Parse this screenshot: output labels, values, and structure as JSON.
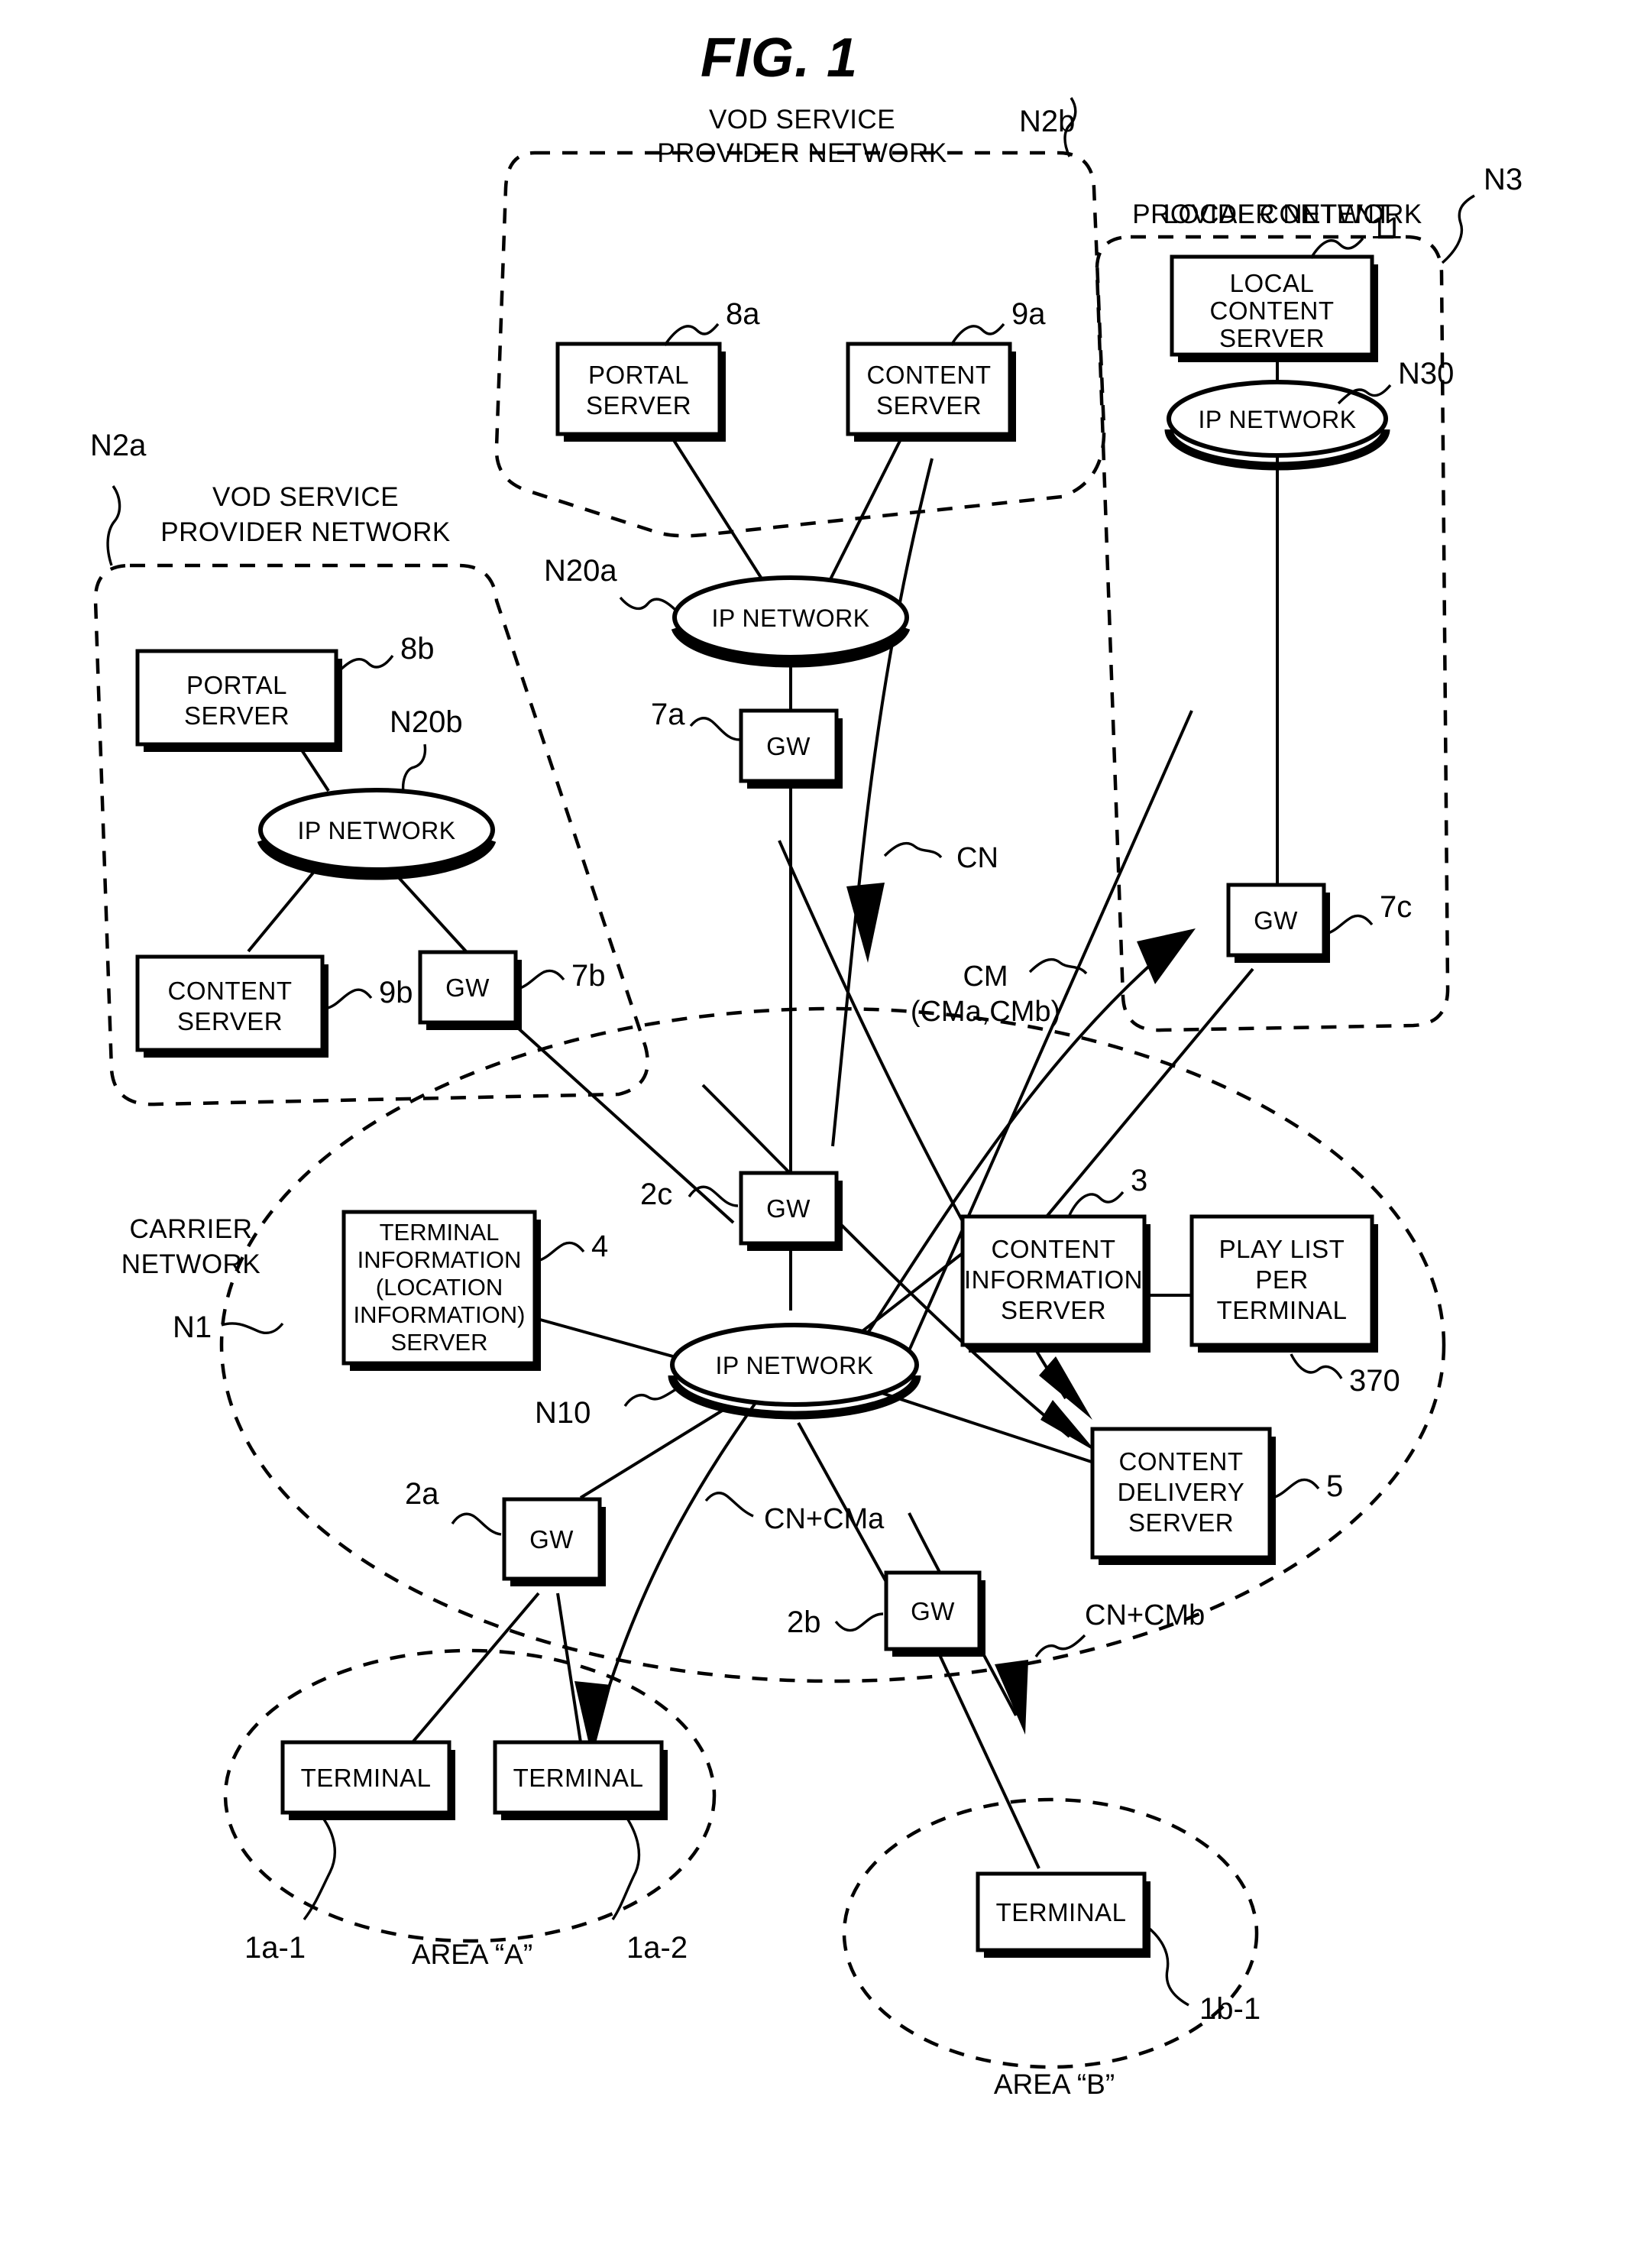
{
  "figure": {
    "title": "FIG. 1"
  },
  "networks": {
    "vod_a": {
      "title_line1": "VOD SERVICE",
      "title_line2": "PROVIDER NETWORK",
      "ref": "N2a"
    },
    "vod_b": {
      "title_line1": "VOD SERVICE",
      "title_line2": "PROVIDER NETWORK",
      "ref": "N2b"
    },
    "local_content": {
      "title_line1": "LOCAL CONTENT",
      "title_line2": "PROVIDER NETWORK",
      "ref": "N3"
    },
    "carrier": {
      "title_line1": "CARRIER",
      "title_line2": "NETWORK",
      "ref": "N1"
    }
  },
  "clouds": {
    "n20a": {
      "label": "IP NETWORK",
      "ref": "N20a"
    },
    "n20b": {
      "label": "IP NETWORK",
      "ref": "N20b"
    },
    "n30": {
      "label": "IP NETWORK",
      "ref": "N30"
    },
    "n10": {
      "label": "IP NETWORK",
      "ref": "N10"
    }
  },
  "blocks": {
    "portal_server_a": {
      "line1": "PORTAL",
      "line2": "SERVER",
      "ref": "8a"
    },
    "content_server_a": {
      "line1": "CONTENT",
      "line2": "SERVER",
      "ref": "9a"
    },
    "portal_server_b": {
      "line1": "PORTAL",
      "line2": "SERVER",
      "ref": "8b"
    },
    "content_server_b": {
      "line1": "CONTENT",
      "line2": "SERVER",
      "ref": "9b"
    },
    "local_content_server": {
      "line1": "LOCAL",
      "line2": "CONTENT",
      "line3": "SERVER",
      "ref": "11"
    },
    "gw_7a": {
      "label": "GW",
      "ref": "7a"
    },
    "gw_7b": {
      "label": "GW",
      "ref": "7b"
    },
    "gw_7c": {
      "label": "GW",
      "ref": "7c"
    },
    "gw_2a": {
      "label": "GW",
      "ref": "2a"
    },
    "gw_2b": {
      "label": "GW",
      "ref": "2b"
    },
    "gw_2c": {
      "label": "GW",
      "ref": "2c"
    },
    "terminal_info_server": {
      "line1": "TERMINAL",
      "line2": "INFORMATION",
      "line3": "(LOCATION",
      "line4": "INFORMATION)",
      "line5": "SERVER",
      "ref": "4"
    },
    "content_info_server": {
      "line1": "CONTENT",
      "line2": "INFORMATION",
      "line3": "SERVER",
      "ref": "3"
    },
    "play_list": {
      "line1": "PLAY LIST",
      "line2": "PER",
      "line3": "TERMINAL",
      "ref": "370"
    },
    "content_delivery_server": {
      "line1": "CONTENT",
      "line2": "DELIVERY",
      "line3": "SERVER",
      "ref": "5"
    },
    "terminal_1a1": {
      "label": "TERMINAL",
      "ref": "1a-1"
    },
    "terminal_1a2": {
      "label": "TERMINAL",
      "ref": "1a-2"
    },
    "terminal_1b1": {
      "label": "TERMINAL",
      "ref": "1b-1"
    }
  },
  "areas": {
    "area_a": "AREA “A”",
    "area_b": "AREA “B”"
  },
  "flows": {
    "cn": "CN",
    "cm_line1": "CM",
    "cm_line2": "(CMa,CMb)",
    "cn_cma": "CN+CMa",
    "cn_cmb": "CN+CMb"
  },
  "colors": {
    "ink": "#000000",
    "paper": "#ffffff"
  }
}
